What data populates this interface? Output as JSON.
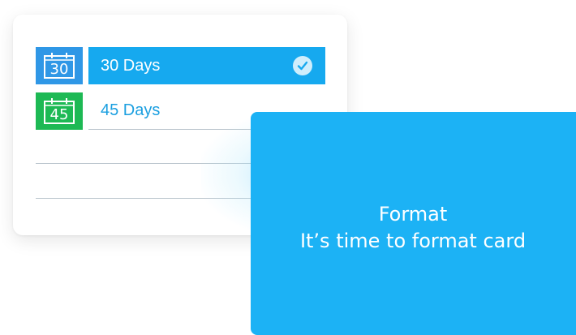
{
  "options": [
    {
      "icon": "calendar-icon",
      "number": "30",
      "label": "30 Days",
      "selected": true,
      "color": "#2f97e6"
    },
    {
      "icon": "calendar-icon",
      "number": "45",
      "label": "45 Days",
      "selected": false,
      "color": "#1db954"
    }
  ],
  "selected_indicator": "check-icon",
  "format_card": {
    "title": "Format",
    "subtitle": "It’s time to format card",
    "color": "#1cb2f5"
  },
  "accent": "#16a9ef"
}
